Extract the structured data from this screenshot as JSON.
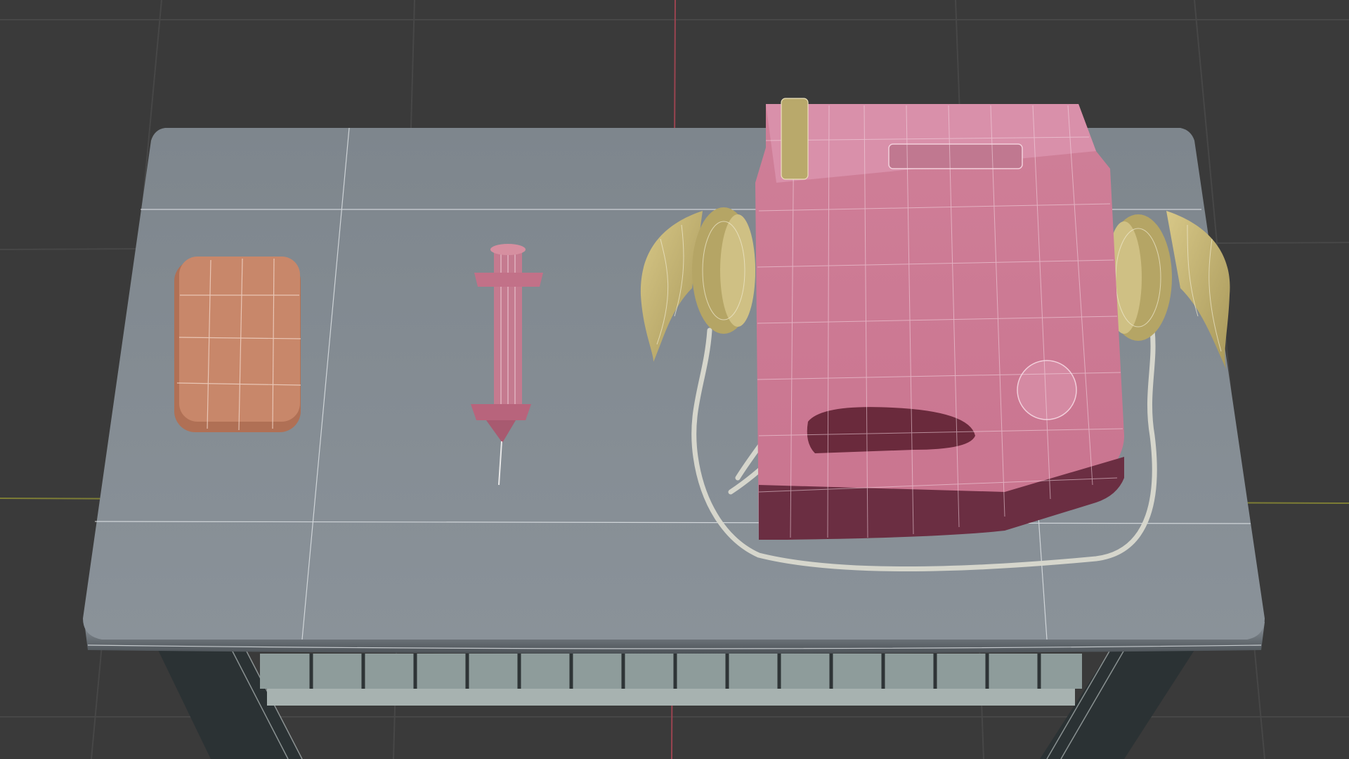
{
  "viewport": {
    "background_color": "#3a3a3a",
    "grid_color": "#4a4a4a",
    "axis_x_color": "#8a8a3a",
    "axis_y_color": "#b04a55",
    "wireframe_color": "#e8e8e8"
  },
  "objects": [
    {
      "name": "table",
      "color": "#808890"
    },
    {
      "name": "soap-bar",
      "color": "#c8876a"
    },
    {
      "name": "syringe",
      "color": "#d68fa0"
    },
    {
      "name": "defibrillator-case",
      "color": "#d98aa5"
    },
    {
      "name": "defibrillator-paddle-left",
      "color": "#c8b872"
    },
    {
      "name": "defibrillator-paddle-right",
      "color": "#c8b872"
    },
    {
      "name": "paddle-cables",
      "color": "#d8d8d0"
    }
  ]
}
